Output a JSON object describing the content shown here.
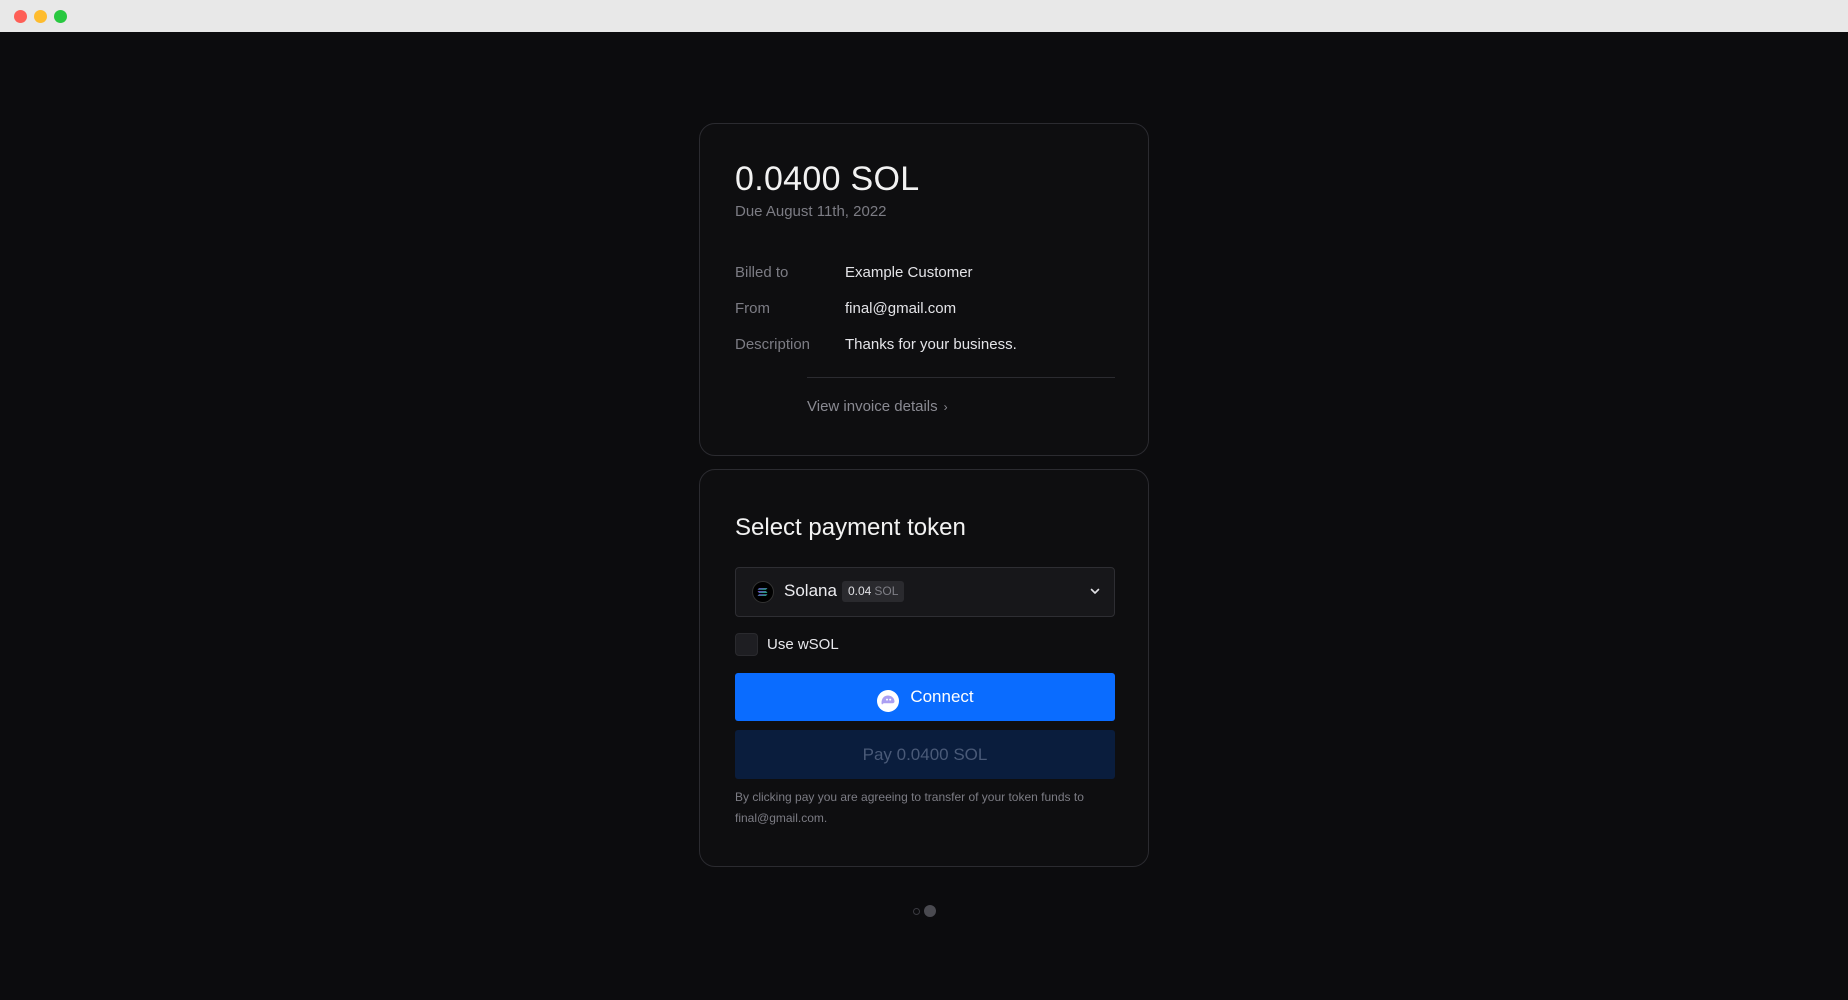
{
  "invoice": {
    "amount": "0.0400 SOL",
    "due": "Due August 11th, 2022",
    "rows": [
      {
        "label": "Billed to",
        "value": "Example Customer"
      },
      {
        "label": "From",
        "value": "final@gmail.com"
      },
      {
        "label": "Description",
        "value": "Thanks for your business."
      }
    ],
    "details_link": "View invoice details"
  },
  "payment": {
    "title": "Select payment token",
    "token": {
      "name": "Solana",
      "badge_amount": "0.04",
      "badge_unit": "SOL",
      "icon": "solana-icon"
    },
    "use_wsol_label": "Use wSOL",
    "connect_label": "Connect",
    "pay_label": "Pay 0.0400 SOL",
    "disclaimer": "By clicking pay you are agreeing to transfer of your token funds to final@gmail.com."
  },
  "colors": {
    "background": "#0c0c0e",
    "card_border": "#2b2b30",
    "connect_button": "#0a6cff",
    "pay_button_disabled": "#0a1d3d"
  }
}
